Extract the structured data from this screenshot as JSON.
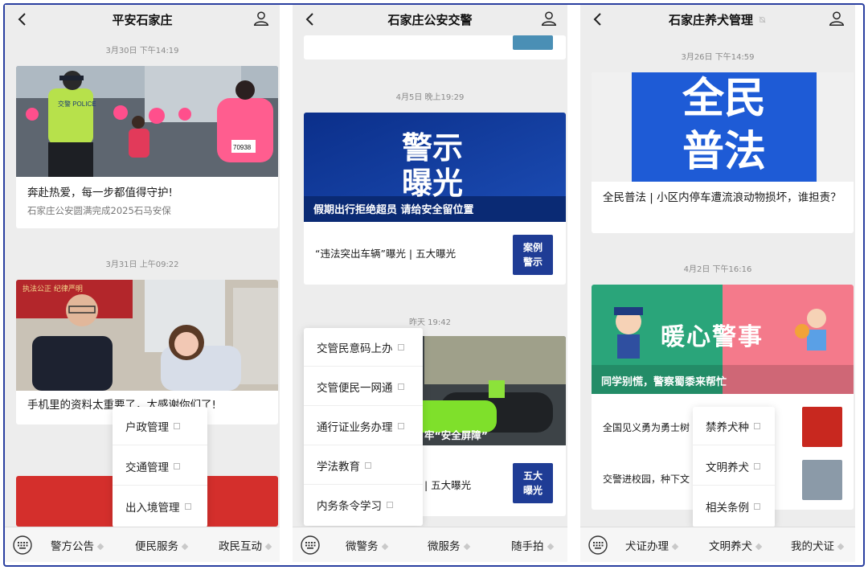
{
  "panels": [
    {
      "title": "平安石家庄",
      "posts": [
        {
          "time": "3月30日 下午14:19",
          "title": "奔赴热爱，每一步都值得守护!",
          "subtitle": "石家庄公安圆满完成2025石马安保"
        },
        {
          "time": "3月31日 上午09:22",
          "title": "手机里的资料太重要了，太感谢你们了!"
        }
      ],
      "photo_text": {
        "vest": "交警 POLICE",
        "bib": "70938",
        "banner": "执法公正 纪律严明"
      },
      "popup": [
        "户政管理",
        "交通管理",
        "出入境管理"
      ],
      "menu": [
        "警方公告",
        "便民服务",
        "政民互动"
      ]
    },
    {
      "title": "石家庄公安交警",
      "posts": [
        {
          "time": "4月5日 晚上19:29",
          "banner_big": "警示\n曝光",
          "banner_caption": "假期出行拒绝超员 请给安全留位置",
          "item": "“违法突出车辆”曝光 | 五大曝光",
          "item_thumb": "案例\n警示"
        },
        {
          "time": "昨天 19:42",
          "banner_caption": "牢“安全屏障”",
          "item": "| 五大曝光",
          "item_thumb": "五大\n曝光"
        }
      ],
      "popup": [
        "交管民意码上办",
        "交管便民一网通",
        "通行证业务办理",
        "学法教育",
        "内务条令学习"
      ],
      "menu": [
        "微警务",
        "微服务",
        "随手拍"
      ]
    },
    {
      "title": "石家庄养犬管理",
      "posts": [
        {
          "time": "3月26日 下午14:59",
          "banner_big": "全民\n普法",
          "title": "全民普法 | 小区内停车遭流浪动物损坏，谁担责？"
        },
        {
          "time": "4月2日 下午16:16",
          "banner_big": "暖心警事",
          "banner_caption": "同学别慌，警察蜀黍来帮忙",
          "items": [
            "全国见义勇为勇士树",
            "交警进校园，种下文"
          ]
        }
      ],
      "popup": [
        "禁养犬种",
        "文明养犬",
        "相关条例"
      ],
      "menu": [
        "犬证办理",
        "文明养犬",
        "我的犬证"
      ]
    }
  ],
  "icons": {
    "back": "chevron-left-icon",
    "user": "user-icon",
    "keyboard": "keyboard-icon",
    "mute": "bell-off-icon"
  }
}
